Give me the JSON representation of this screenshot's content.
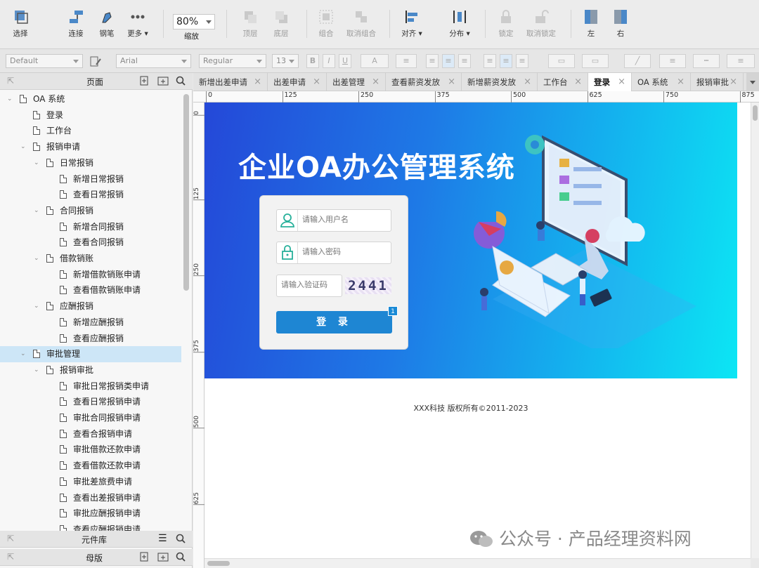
{
  "toolbar": {
    "select": "选择",
    "connect": "连接",
    "pen": "钢笔",
    "more": "更多 ▾",
    "zoom_value": "80%",
    "zoom_label": "缩放",
    "top_layer": "顶层",
    "bottom_layer": "底层",
    "group": "组合",
    "ungroup": "取消组合",
    "align": "对齐 ▾",
    "distribute": "分布 ▾",
    "lock": "锁定",
    "unlock": "取消锁定",
    "left": "左",
    "right": "右"
  },
  "format_bar": {
    "style": "Default",
    "font": "Arial",
    "weight": "Regular",
    "size": "13",
    "bold": "B",
    "italic": "I",
    "underline": "U",
    "font_color": "A"
  },
  "sidebar": {
    "pages_title": "页面",
    "library_title": "元件库",
    "masters_title": "母版",
    "tree": [
      {
        "label": "OA 系统",
        "level": 0,
        "caret": true
      },
      {
        "label": "登录",
        "level": 1,
        "caret": false
      },
      {
        "label": "工作台",
        "level": 1,
        "caret": false
      },
      {
        "label": "报销申请",
        "level": 1,
        "caret": true
      },
      {
        "label": "日常报销",
        "level": 2,
        "caret": true
      },
      {
        "label": "新增日常报销",
        "level": 3,
        "caret": false
      },
      {
        "label": "查看日常报销",
        "level": 3,
        "caret": false
      },
      {
        "label": "合同报销",
        "level": 2,
        "caret": true
      },
      {
        "label": "新增合同报销",
        "level": 3,
        "caret": false
      },
      {
        "label": "查看合同报销",
        "level": 3,
        "caret": false
      },
      {
        "label": "借款销账",
        "level": 2,
        "caret": true
      },
      {
        "label": "新增借款销账申请",
        "level": 3,
        "caret": false
      },
      {
        "label": "查看借款销账申请",
        "level": 3,
        "caret": false
      },
      {
        "label": "应酬报销",
        "level": 2,
        "caret": true
      },
      {
        "label": "新增应酬报销",
        "level": 3,
        "caret": false
      },
      {
        "label": "查看应酬报销",
        "level": 3,
        "caret": false
      },
      {
        "label": "审批管理",
        "level": 1,
        "caret": true,
        "active": true
      },
      {
        "label": "报销审批",
        "level": 2,
        "caret": true
      },
      {
        "label": "审批日常报销类申请",
        "level": 3,
        "caret": false
      },
      {
        "label": "查看日常报销申请",
        "level": 3,
        "caret": false
      },
      {
        "label": "审批合同报销申请",
        "level": 3,
        "caret": false
      },
      {
        "label": "查看合报销申请",
        "level": 3,
        "caret": false
      },
      {
        "label": "审批借款还款申请",
        "level": 3,
        "caret": false
      },
      {
        "label": "查看借款还款申请",
        "level": 3,
        "caret": false
      },
      {
        "label": "审批差旅费申请",
        "level": 3,
        "caret": false
      },
      {
        "label": "查看出差报销申请",
        "level": 3,
        "caret": false
      },
      {
        "label": "审批应酬报销申请",
        "level": 3,
        "caret": false
      },
      {
        "label": "查看应酬报销申请",
        "level": 3,
        "caret": false
      }
    ]
  },
  "tabs": [
    {
      "label": "新增出差申请"
    },
    {
      "label": "出差申请"
    },
    {
      "label": "出差管理"
    },
    {
      "label": "查看薪资发放"
    },
    {
      "label": "新增薪资发放"
    },
    {
      "label": "工作台"
    },
    {
      "label": "登录",
      "active": true
    },
    {
      "label": "OA 系统"
    },
    {
      "label": "报销审批"
    }
  ],
  "rulers": {
    "h_ticks": [
      "0",
      "125",
      "250",
      "375",
      "500",
      "625",
      "750",
      "875"
    ],
    "v_ticks": [
      "0",
      "125",
      "250",
      "375",
      "500",
      "625"
    ]
  },
  "page": {
    "title": "企业OA办公管理系统",
    "username_placeholder": "请输入用户名",
    "password_placeholder": "请输入密码",
    "captcha_placeholder": "请输入验证码",
    "captcha_code": "2441",
    "login_button": "登 录",
    "badge": "1",
    "footer": "XXX科技 版权所有©2011-2023"
  },
  "watermark": "公众号 · 产品经理资料网",
  "colors": {
    "banner_start": "#2448d8",
    "banner_end": "#0ce6f4",
    "login_button": "#1e86d3",
    "tree_active": "#cde6f7"
  }
}
